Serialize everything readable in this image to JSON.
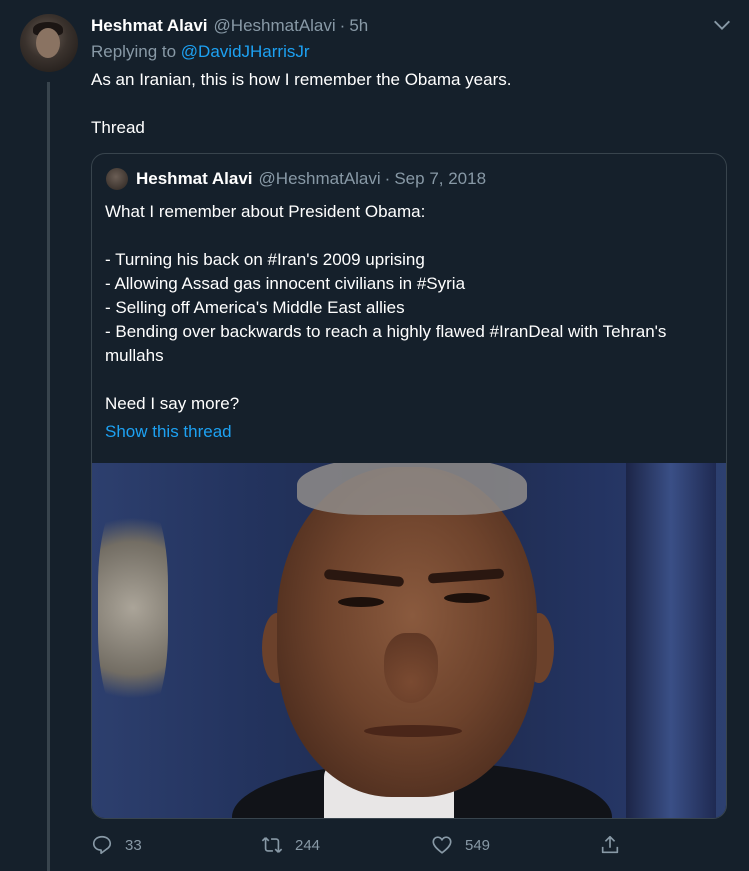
{
  "tweet": {
    "name": "Heshmat Alavi",
    "handle": "@HeshmatAlavi",
    "separator": "·",
    "time": "5h",
    "reply_prefix": "Replying to",
    "reply_to": "@DavidJHarrisJr",
    "text_line1": "As an Iranian, this is how I remember the Obama years.",
    "text_line2": "Thread"
  },
  "quoted": {
    "name": "Heshmat Alavi",
    "handle": "@HeshmatAlavi",
    "separator": "·",
    "date": "Sep 7, 2018",
    "line1": "What I remember about President Obama:",
    "line2": "- Turning his back on #Iran's 2009 uprising",
    "line3": "- Allowing Assad gas innocent civilians in #Syria",
    "line4": "- Selling off America's Middle East allies",
    "line5": "- Bending over backwards to reach a highly flawed #IranDeal with Tehran's mullahs",
    "line6": "Need I say more?",
    "show_thread": "Show this thread"
  },
  "actions": {
    "replies": "33",
    "retweets": "244",
    "likes": "549"
  },
  "icons": [
    "chevron-down-icon",
    "reply-icon",
    "retweet-icon",
    "like-icon",
    "share-icon"
  ],
  "colors": {
    "background": "#15202b",
    "link": "#1da1f2",
    "muted": "#8899a6",
    "border": "#38444d"
  }
}
